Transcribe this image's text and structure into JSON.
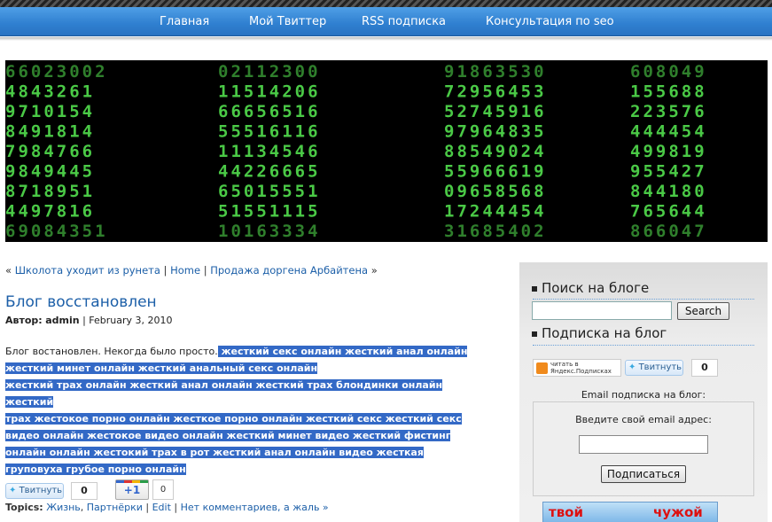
{
  "nav": {
    "items": [
      {
        "label": "Главная"
      },
      {
        "label": "Мой Твиттер"
      },
      {
        "label": "RSS подписка"
      },
      {
        "label": "Консультация по seo"
      }
    ]
  },
  "banner": {
    "columns": [
      [
        "66023002",
        "484326 1",
        "9710154",
        "8491814",
        "7984766",
        "9849445",
        "8718951",
        "4497816",
        "69084351"
      ],
      [
        "02112300",
        "11514206",
        "66656516",
        "55516116",
        "11134546",
        "44226665",
        "65015551",
        "51551115",
        "10163334"
      ],
      [
        "918635 30",
        "7295645 3",
        "5274591 6",
        "9796483 5",
        "8854902 4",
        "5596661 9",
        "0965856 8",
        "1724445 4",
        "31685402"
      ],
      [
        "608049",
        "155688",
        "223576",
        "444454",
        "499819",
        "955427",
        "844180",
        "765644",
        "866047"
      ]
    ],
    "digit_color": "#4fd44a"
  },
  "breadcrumb": {
    "prefix": "«",
    "prev": "Школота уходит из рунета",
    "sep1": "|",
    "home": "Home",
    "sep2": "|",
    "next": "Продажа доргена Арбайтена",
    "suffix": "»"
  },
  "post": {
    "title": "Блог восстановлен",
    "author_label": "Автор:",
    "author": "admin",
    "date_sep": "|",
    "date": "February 3, 2010",
    "text_plain": "Блог востановлен. Некогда было просто.",
    "text_highlighted": [
      " жесткий секс онлайн жесткий анал онлайн",
      "жесткий минет онлайн жесткий анальный секс онлайн",
      "жесткий трах онлайн жесткий анал онлайн жесткий трах блондинки онлайн жесткий",
      "трах жестокое порно онлайн жесткое порно онлайн жесткий секс жесткий секс",
      "видео онлайн жестокое видео онлайн жесткий минет видео жесткий фистинг",
      "онлайн онлайн жестокий трах в рот жесткий анал онлайн видео жесткая",
      "груповуха грубое порно онлайн"
    ],
    "tweet_label": "Твитнуть",
    "tweet_count": "0",
    "gplus_label": "+1",
    "gplus_count": "0",
    "topics_label": "Topics:",
    "topic1": "Жизнь",
    "topic_sep": ",",
    "topic2": "Партнёрки",
    "sep_a": "|",
    "edit": "Edit",
    "sep_b": "|",
    "comments": "Нет комментариев, а жаль »"
  },
  "sidebar": {
    "search_title": "Поиск на блоге",
    "search_button": "Search",
    "search_value": "",
    "subscribe_title": "Подписка на блог",
    "yandex_line1": "читать в",
    "yandex_line2": "Яндекс.Подписках",
    "tweet_label": "Твитнуть",
    "tweet_count": "0",
    "email_title": "Email подписка на блог:",
    "email_prompt": "Введите свой email адрес:",
    "email_value": "",
    "subscribe_button": "Подписаться",
    "promo_left": "твой",
    "promo_right": "чужой"
  },
  "colors": {
    "nav": "#2f7fd0",
    "link": "#1c5fa8",
    "selection": "#3369c6"
  }
}
